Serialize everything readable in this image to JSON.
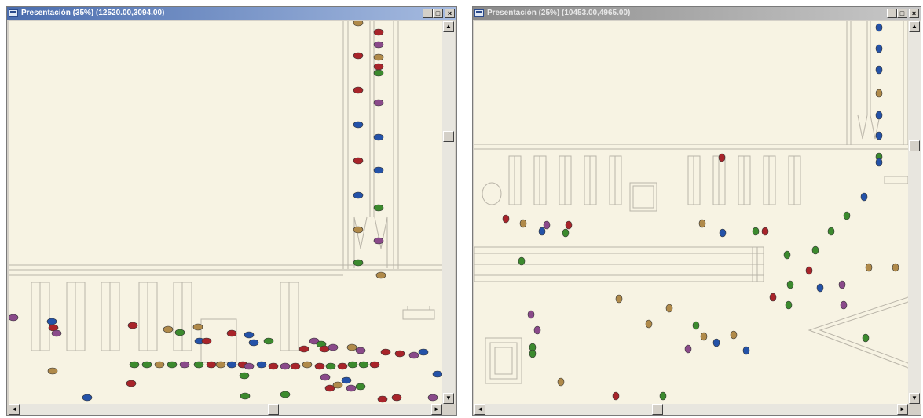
{
  "windows": [
    {
      "title": "Presentación (35%) (12520.00,3094.00)",
      "active": true,
      "buttons": {
        "minimize": "_",
        "maximize": "□",
        "close": "×"
      },
      "zoom_percent": 35,
      "coordinates": "12520.00,3094.00"
    },
    {
      "title": "Presentación (25%) (10453.00,4965.00)",
      "active": false,
      "buttons": {
        "minimize": "_",
        "maximize": "□",
        "close": "×"
      },
      "zoom_percent": 25,
      "coordinates": "10453.00,4965.00"
    }
  ],
  "scroll_arrows": {
    "up": "▲",
    "down": "▼",
    "left": "◄",
    "right": "►"
  },
  "colors": {
    "canvas": "#f7f3e3",
    "lines": "#b9b4a8",
    "agent_red": "#a8242a",
    "agent_blue": "#2452a8",
    "agent_green": "#3c8a2e",
    "agent_purple": "#8a4a8a",
    "agent_tan": "#b08a4a"
  }
}
